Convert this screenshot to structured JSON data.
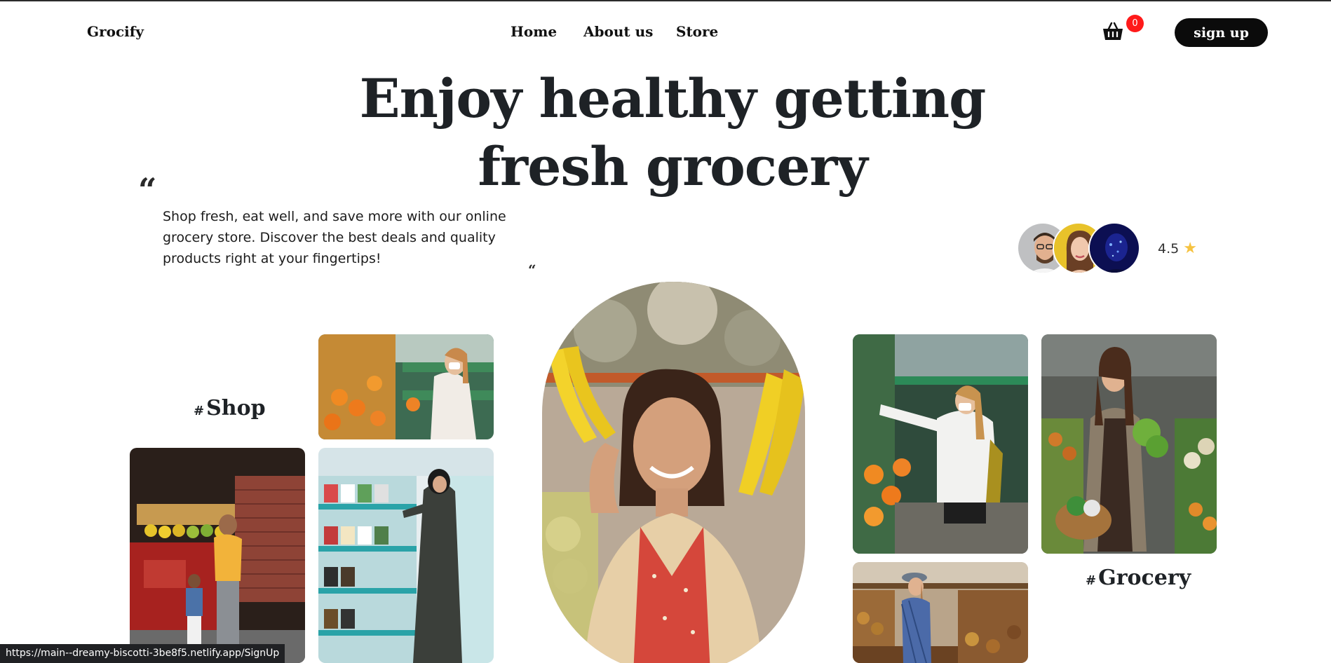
{
  "brand": {
    "logo": "Grocify"
  },
  "nav": {
    "items": [
      {
        "label": "Home"
      },
      {
        "label": "About us"
      },
      {
        "label": "Store"
      }
    ]
  },
  "cart": {
    "count": "0",
    "icon": "basket-icon"
  },
  "signup": {
    "label": "sign up"
  },
  "hero": {
    "headline": "Enjoy healthy getting fresh grocery",
    "tagline": "Shop fresh, eat well, and save more with our online grocery store. Discover the best deals and quality products right at your fingertips!",
    "quote_open": "“",
    "quote_close": "“"
  },
  "reviews": {
    "rating": "4.5",
    "star_icon": "star-icon",
    "star_color": "#f6c341"
  },
  "tags": {
    "shop": "Shop",
    "grocery": "Grocery",
    "hash": "#"
  },
  "colors": {
    "text": "#1e2226",
    "button": "#0b0b0b",
    "badge": "#ff1a1a"
  },
  "status_bar": {
    "url": "https://main--dreamy-biscotti-3be8f5.netlify.app/SignUp"
  }
}
